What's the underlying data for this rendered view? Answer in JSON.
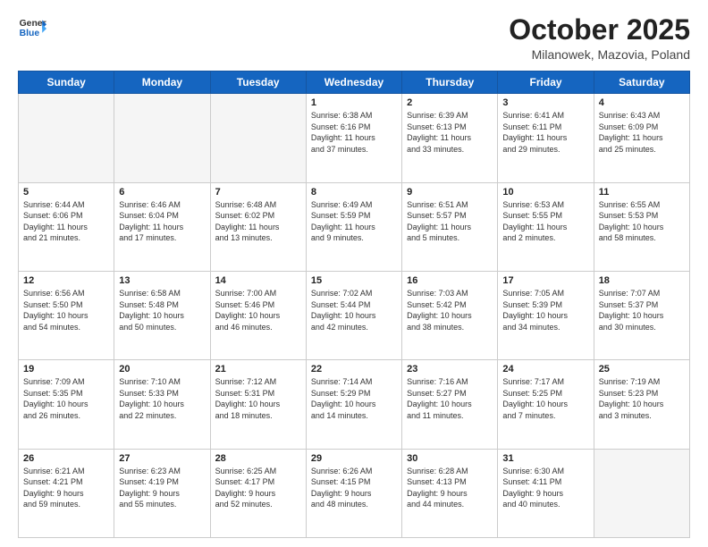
{
  "logo": {
    "line1": "General",
    "line2": "Blue"
  },
  "title": "October 2025",
  "subtitle": "Milanowek, Mazovia, Poland",
  "weekdays": [
    "Sunday",
    "Monday",
    "Tuesday",
    "Wednesday",
    "Thursday",
    "Friday",
    "Saturday"
  ],
  "weeks": [
    [
      {
        "day": "",
        "info": ""
      },
      {
        "day": "",
        "info": ""
      },
      {
        "day": "",
        "info": ""
      },
      {
        "day": "1",
        "info": "Sunrise: 6:38 AM\nSunset: 6:16 PM\nDaylight: 11 hours\nand 37 minutes."
      },
      {
        "day": "2",
        "info": "Sunrise: 6:39 AM\nSunset: 6:13 PM\nDaylight: 11 hours\nand 33 minutes."
      },
      {
        "day": "3",
        "info": "Sunrise: 6:41 AM\nSunset: 6:11 PM\nDaylight: 11 hours\nand 29 minutes."
      },
      {
        "day": "4",
        "info": "Sunrise: 6:43 AM\nSunset: 6:09 PM\nDaylight: 11 hours\nand 25 minutes."
      }
    ],
    [
      {
        "day": "5",
        "info": "Sunrise: 6:44 AM\nSunset: 6:06 PM\nDaylight: 11 hours\nand 21 minutes."
      },
      {
        "day": "6",
        "info": "Sunrise: 6:46 AM\nSunset: 6:04 PM\nDaylight: 11 hours\nand 17 minutes."
      },
      {
        "day": "7",
        "info": "Sunrise: 6:48 AM\nSunset: 6:02 PM\nDaylight: 11 hours\nand 13 minutes."
      },
      {
        "day": "8",
        "info": "Sunrise: 6:49 AM\nSunset: 5:59 PM\nDaylight: 11 hours\nand 9 minutes."
      },
      {
        "day": "9",
        "info": "Sunrise: 6:51 AM\nSunset: 5:57 PM\nDaylight: 11 hours\nand 5 minutes."
      },
      {
        "day": "10",
        "info": "Sunrise: 6:53 AM\nSunset: 5:55 PM\nDaylight: 11 hours\nand 2 minutes."
      },
      {
        "day": "11",
        "info": "Sunrise: 6:55 AM\nSunset: 5:53 PM\nDaylight: 10 hours\nand 58 minutes."
      }
    ],
    [
      {
        "day": "12",
        "info": "Sunrise: 6:56 AM\nSunset: 5:50 PM\nDaylight: 10 hours\nand 54 minutes."
      },
      {
        "day": "13",
        "info": "Sunrise: 6:58 AM\nSunset: 5:48 PM\nDaylight: 10 hours\nand 50 minutes."
      },
      {
        "day": "14",
        "info": "Sunrise: 7:00 AM\nSunset: 5:46 PM\nDaylight: 10 hours\nand 46 minutes."
      },
      {
        "day": "15",
        "info": "Sunrise: 7:02 AM\nSunset: 5:44 PM\nDaylight: 10 hours\nand 42 minutes."
      },
      {
        "day": "16",
        "info": "Sunrise: 7:03 AM\nSunset: 5:42 PM\nDaylight: 10 hours\nand 38 minutes."
      },
      {
        "day": "17",
        "info": "Sunrise: 7:05 AM\nSunset: 5:39 PM\nDaylight: 10 hours\nand 34 minutes."
      },
      {
        "day": "18",
        "info": "Sunrise: 7:07 AM\nSunset: 5:37 PM\nDaylight: 10 hours\nand 30 minutes."
      }
    ],
    [
      {
        "day": "19",
        "info": "Sunrise: 7:09 AM\nSunset: 5:35 PM\nDaylight: 10 hours\nand 26 minutes."
      },
      {
        "day": "20",
        "info": "Sunrise: 7:10 AM\nSunset: 5:33 PM\nDaylight: 10 hours\nand 22 minutes."
      },
      {
        "day": "21",
        "info": "Sunrise: 7:12 AM\nSunset: 5:31 PM\nDaylight: 10 hours\nand 18 minutes."
      },
      {
        "day": "22",
        "info": "Sunrise: 7:14 AM\nSunset: 5:29 PM\nDaylight: 10 hours\nand 14 minutes."
      },
      {
        "day": "23",
        "info": "Sunrise: 7:16 AM\nSunset: 5:27 PM\nDaylight: 10 hours\nand 11 minutes."
      },
      {
        "day": "24",
        "info": "Sunrise: 7:17 AM\nSunset: 5:25 PM\nDaylight: 10 hours\nand 7 minutes."
      },
      {
        "day": "25",
        "info": "Sunrise: 7:19 AM\nSunset: 5:23 PM\nDaylight: 10 hours\nand 3 minutes."
      }
    ],
    [
      {
        "day": "26",
        "info": "Sunrise: 6:21 AM\nSunset: 4:21 PM\nDaylight: 9 hours\nand 59 minutes."
      },
      {
        "day": "27",
        "info": "Sunrise: 6:23 AM\nSunset: 4:19 PM\nDaylight: 9 hours\nand 55 minutes."
      },
      {
        "day": "28",
        "info": "Sunrise: 6:25 AM\nSunset: 4:17 PM\nDaylight: 9 hours\nand 52 minutes."
      },
      {
        "day": "29",
        "info": "Sunrise: 6:26 AM\nSunset: 4:15 PM\nDaylight: 9 hours\nand 48 minutes."
      },
      {
        "day": "30",
        "info": "Sunrise: 6:28 AM\nSunset: 4:13 PM\nDaylight: 9 hours\nand 44 minutes."
      },
      {
        "day": "31",
        "info": "Sunrise: 6:30 AM\nSunset: 4:11 PM\nDaylight: 9 hours\nand 40 minutes."
      },
      {
        "day": "",
        "info": ""
      }
    ]
  ]
}
